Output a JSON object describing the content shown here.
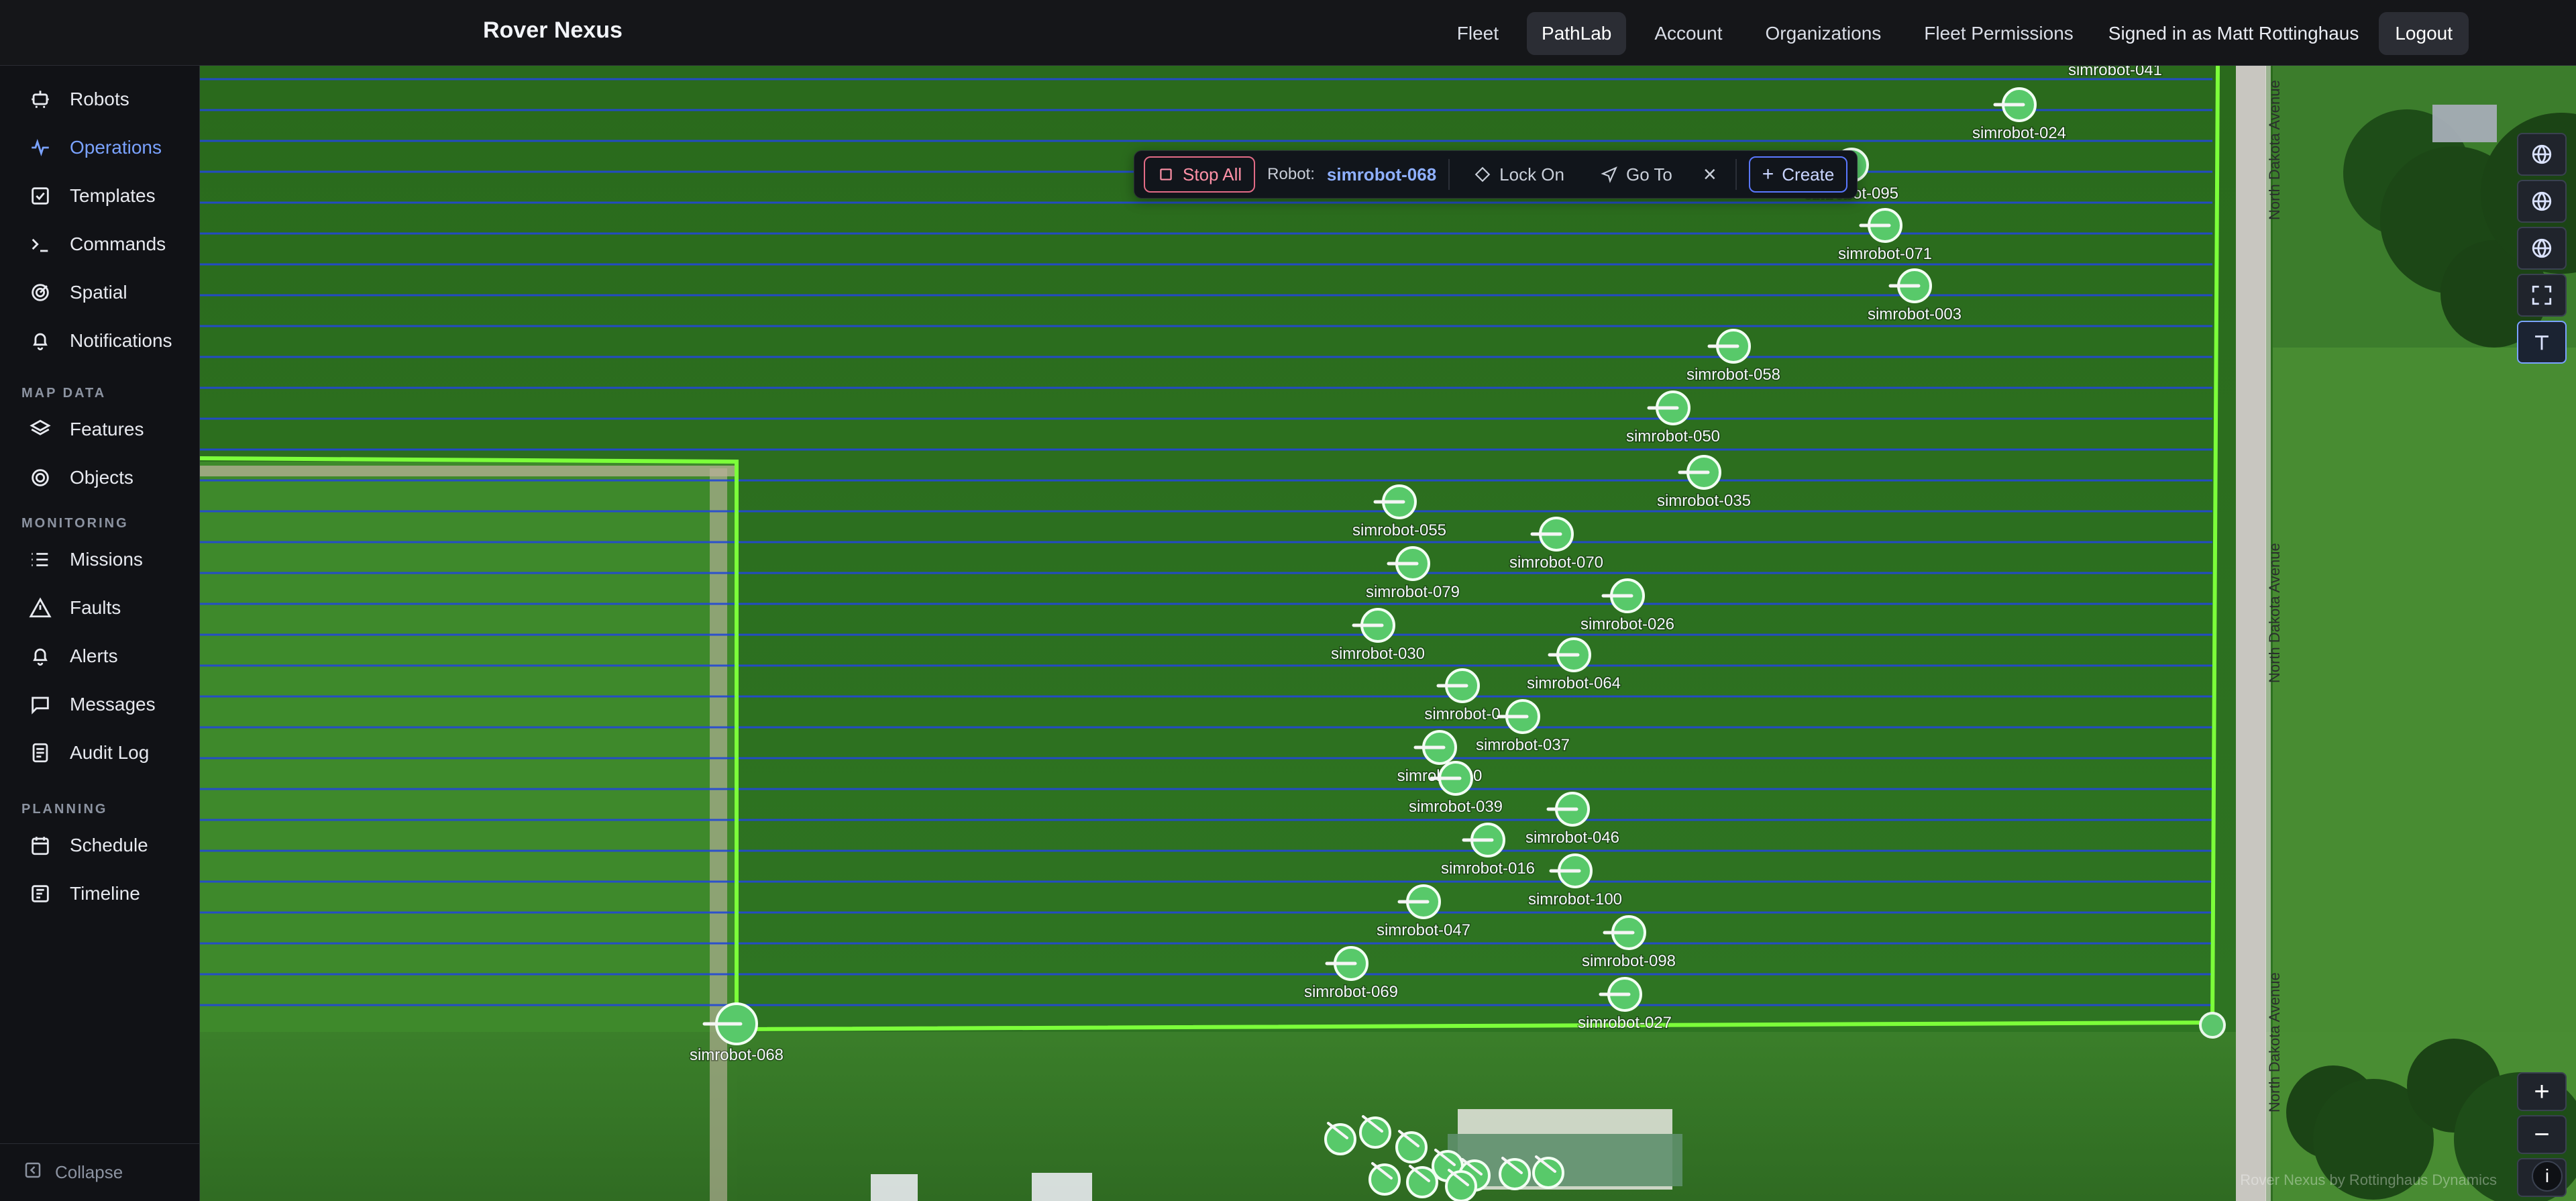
{
  "app": {
    "brand": "Rover Nexus",
    "nav": [
      "Fleet",
      "PathLab",
      "Account",
      "Organizations",
      "Fleet Permissions"
    ],
    "signed_in": "Signed in as Matt Rottinghaus",
    "logout": "Logout"
  },
  "sidebar": {
    "items": [
      {
        "label": "Robots",
        "icon": "robot-icon"
      },
      {
        "label": "Operations",
        "icon": "pulse-icon",
        "active": true
      },
      {
        "label": "Templates",
        "icon": "checkbox-icon"
      },
      {
        "label": "Commands",
        "icon": "terminal-icon"
      },
      {
        "label": "Spatial",
        "icon": "target-icon"
      },
      {
        "label": "Notifications",
        "icon": "bell-icon"
      }
    ],
    "sections": [
      {
        "title": "MAP DATA",
        "items": [
          {
            "label": "Features",
            "icon": "layers-icon"
          },
          {
            "label": "Objects",
            "icon": "target2-icon"
          }
        ]
      },
      {
        "title": "MONITORING",
        "items": [
          {
            "label": "Missions",
            "icon": "list-icon"
          },
          {
            "label": "Faults",
            "icon": "warning-icon"
          },
          {
            "label": "Alerts",
            "icon": "bell-icon"
          },
          {
            "label": "Messages",
            "icon": "chat-icon"
          },
          {
            "label": "Audit Log",
            "icon": "audit-icon"
          }
        ]
      },
      {
        "title": "PLANNING",
        "items": [
          {
            "label": "Schedule",
            "icon": "calendar-icon"
          },
          {
            "label": "Timeline",
            "icon": "timeline-icon"
          }
        ]
      }
    ],
    "collapse": "Collapse"
  },
  "toolbar": {
    "stop_all": "Stop All",
    "robot_label": "Robot:",
    "robot_value": "simrobot-068",
    "lock_on": "Lock On",
    "go_to": "Go To",
    "close": "×",
    "create": "Create"
  },
  "map": {
    "roads": [
      "North Dakota Avenue",
      "North Dakota Avenue",
      "North Dakota Avenue"
    ],
    "attribution": "Rover Nexus by Rottinghaus Dynamics",
    "zoom": {
      "in": "+",
      "out": "−",
      "north": "▲"
    }
  },
  "robots": [
    {
      "name": "simrobot-041"
    },
    {
      "name": "simrobot-024"
    },
    {
      "name": "simrobot-095"
    },
    {
      "name": "simrobot-071"
    },
    {
      "name": "simrobot-003"
    },
    {
      "name": "simrobot-058"
    },
    {
      "name": "simrobot-050"
    },
    {
      "name": "simrobot-035"
    },
    {
      "name": "simrobot-055"
    },
    {
      "name": "simrobot-070"
    },
    {
      "name": "simrobot-079"
    },
    {
      "name": "simrobot-026"
    },
    {
      "name": "simrobot-030"
    },
    {
      "name": "simrobot-064"
    },
    {
      "name": "simrobot-0"
    },
    {
      "name": "simrobot-037"
    },
    {
      "name": "simrobot-20"
    },
    {
      "name": "simrobot-039"
    },
    {
      "name": "simrobot-046"
    },
    {
      "name": "simrobot-016"
    },
    {
      "name": "simrobot-100"
    },
    {
      "name": "simrobot-047"
    },
    {
      "name": "simrobot-098"
    },
    {
      "name": "simrobot-069"
    },
    {
      "name": "simrobot-027"
    },
    {
      "name": "simrobot-068"
    }
  ]
}
